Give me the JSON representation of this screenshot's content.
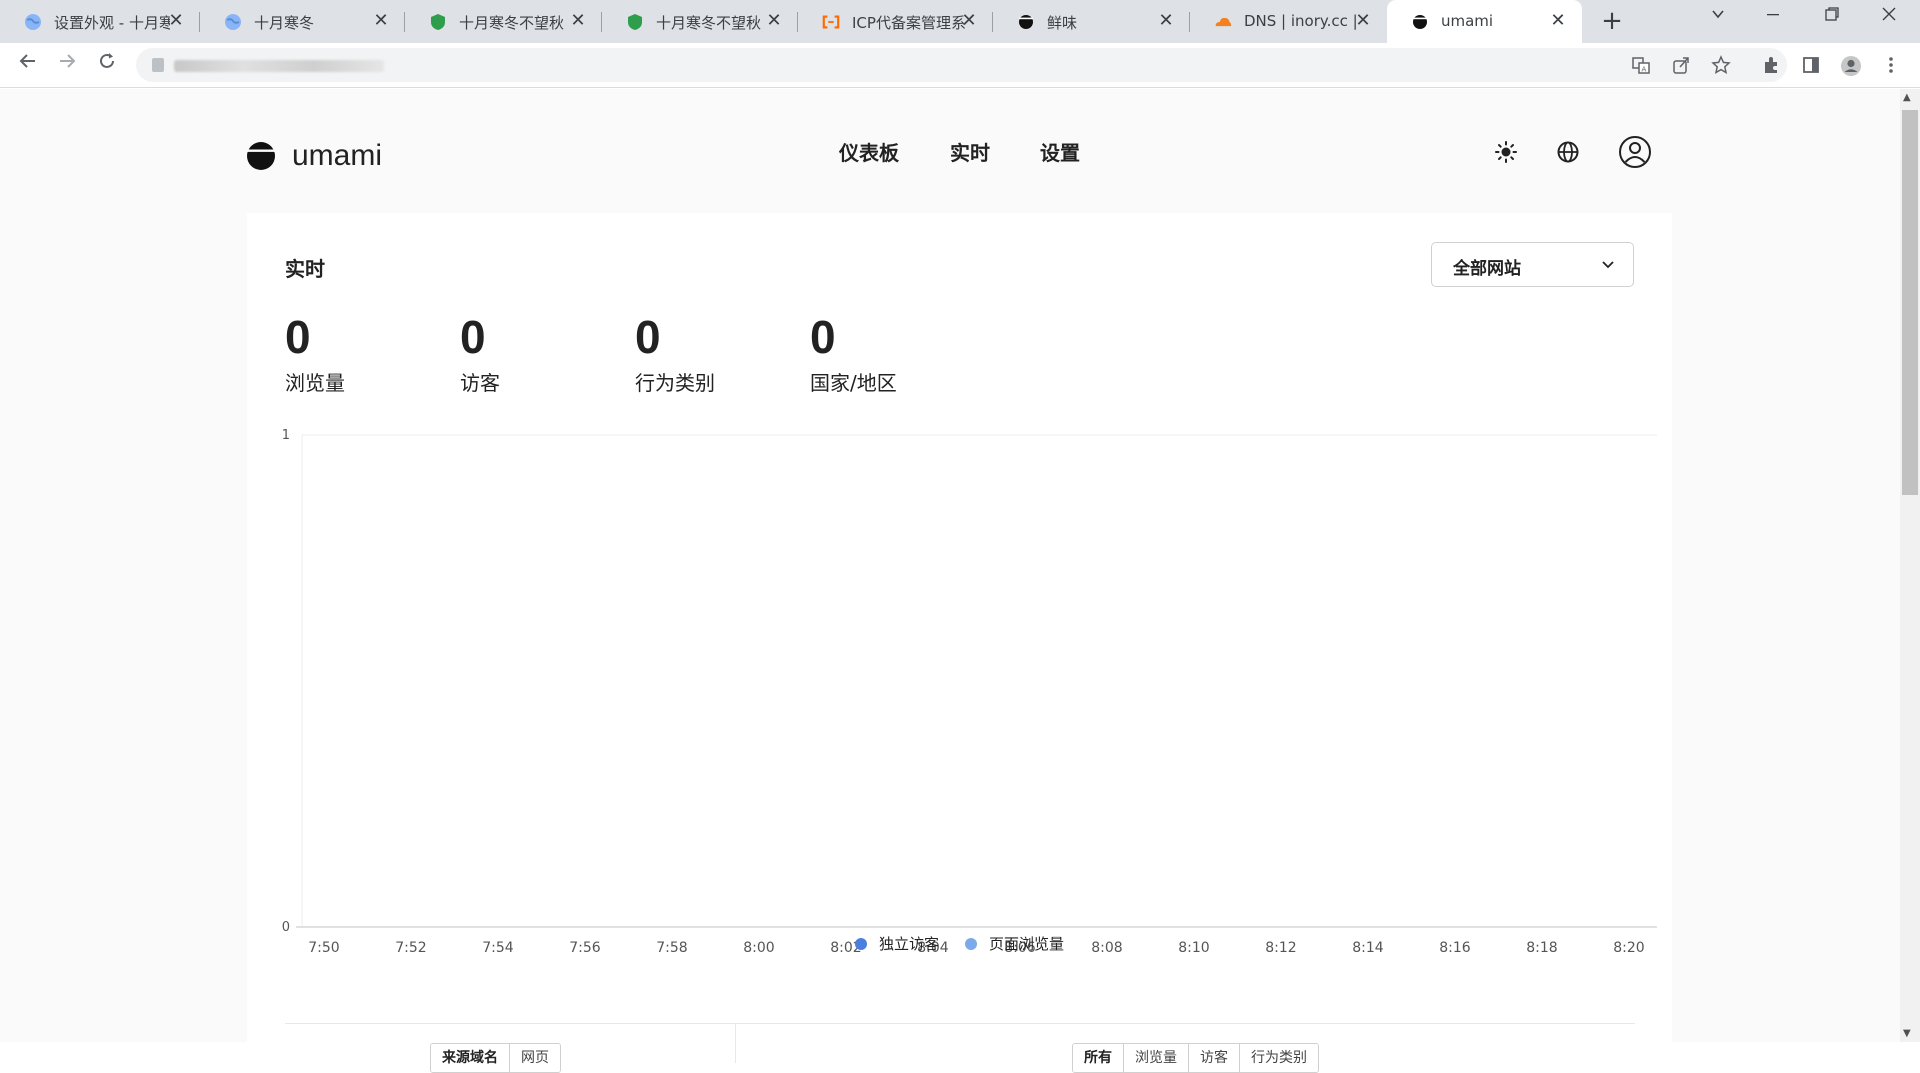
{
  "browser": {
    "tabs": [
      {
        "title": "设置外观 - 十月寒",
        "favicon": "globe-icon",
        "active": false
      },
      {
        "title": "十月寒冬",
        "favicon": "globe-icon",
        "active": false
      },
      {
        "title": "十月寒冬不望秋",
        "favicon": "shield-icon",
        "active": false
      },
      {
        "title": "十月寒冬不望秋",
        "favicon": "shield-icon",
        "active": false
      },
      {
        "title": "ICP代备案管理系",
        "favicon": "aliyun-icon",
        "active": false
      },
      {
        "title": "鲜味",
        "favicon": "umami-icon",
        "active": false
      },
      {
        "title": "DNS | inory.cc |",
        "favicon": "cloudflare-icon",
        "active": false
      },
      {
        "title": "umami",
        "favicon": "umami-icon",
        "active": true
      }
    ],
    "new_tab_symbol": "+",
    "close_symbol": "✕"
  },
  "app": {
    "logo_text": "umami",
    "nav": {
      "dashboard": "仪表板",
      "realtime": "实时",
      "settings": "设置"
    },
    "card_title": "实时",
    "website_select": "全部网站",
    "metrics": [
      {
        "value": "0",
        "label": "浏览量"
      },
      {
        "value": "0",
        "label": "访客"
      },
      {
        "value": "0",
        "label": "行为类别"
      },
      {
        "value": "0",
        "label": "国家/地区"
      }
    ],
    "legend": {
      "visitors": "独立访客",
      "pageviews": "页面浏览量"
    },
    "left_tabs": [
      "来源域名",
      "网页"
    ],
    "right_tabs": [
      "所有",
      "浏览量",
      "访客",
      "行为类别"
    ]
  },
  "chart_data": {
    "type": "bar",
    "categories": [
      "7:50",
      "7:52",
      "7:54",
      "7:56",
      "7:58",
      "8:00",
      "8:02",
      "8:04",
      "8:06",
      "8:08",
      "8:10",
      "8:12",
      "8:14",
      "8:16",
      "8:18",
      "8:20"
    ],
    "ylim": [
      0,
      1
    ],
    "yticks": [
      "0",
      "1"
    ],
    "series": [
      {
        "name": "独立访客",
        "color": "#4a7fe0",
        "values": [
          0,
          0,
          0,
          0,
          0,
          0,
          0,
          0,
          0,
          0,
          0,
          0,
          0,
          0,
          0,
          0
        ]
      },
      {
        "name": "页面浏览量",
        "color": "#7ca9e8",
        "values": [
          0,
          0,
          0,
          0,
          0,
          0,
          0,
          0,
          0,
          0,
          0,
          0,
          0,
          0,
          0,
          0
        ]
      }
    ]
  }
}
